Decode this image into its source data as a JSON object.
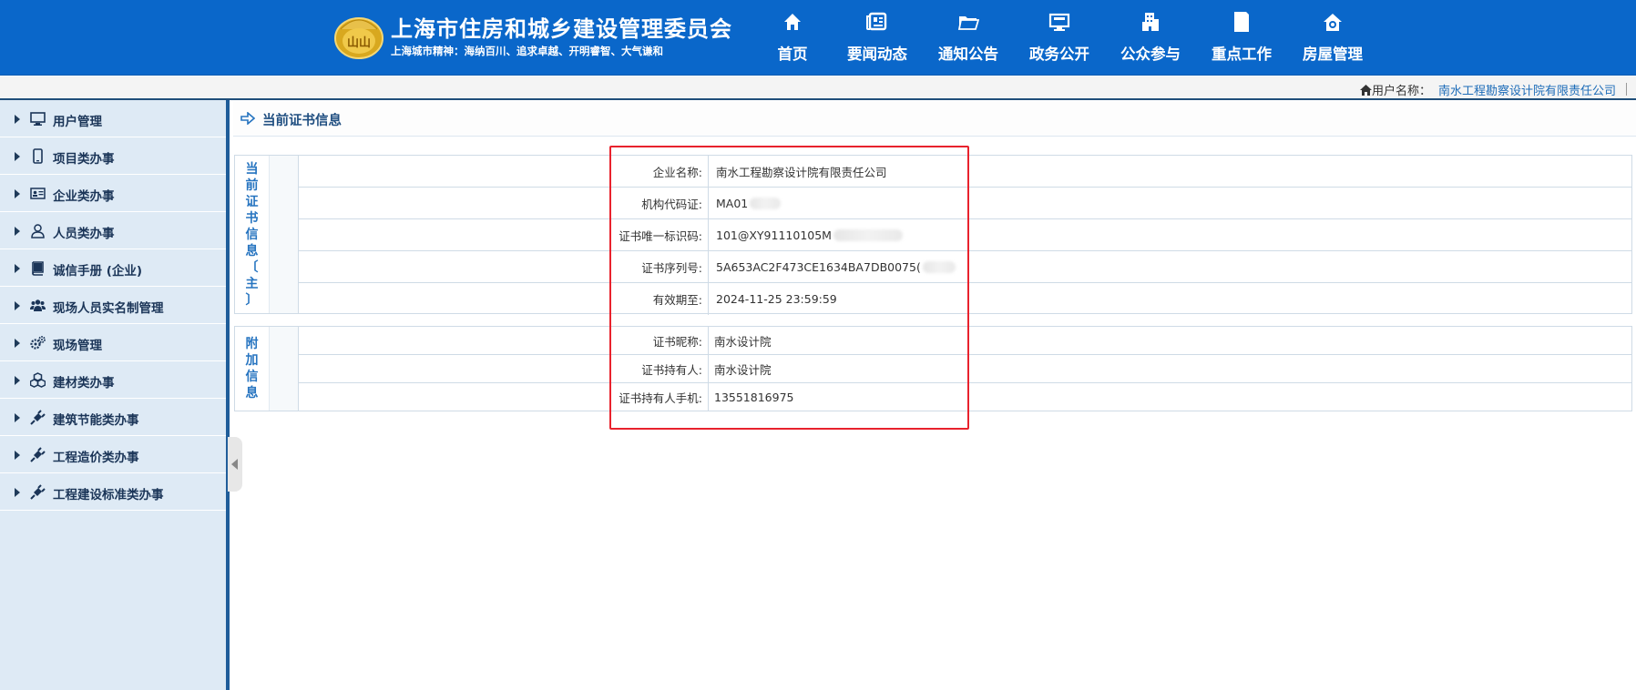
{
  "header": {
    "title": "上海市住房和城乡建设管理委员会",
    "slogan": "上海城市精神：海纳百川、追求卓越、开明睿智、大气谦和",
    "logo_text": "山山",
    "nav": [
      {
        "label": "首页",
        "icon": "home-icon"
      },
      {
        "label": "要闻动态",
        "icon": "news-icon"
      },
      {
        "label": "通知公告",
        "icon": "folder-icon"
      },
      {
        "label": "政务公开",
        "icon": "monitor-icon"
      },
      {
        "label": "公众参与",
        "icon": "building-icon"
      },
      {
        "label": "重点工作",
        "icon": "document-icon"
      },
      {
        "label": "房屋管理",
        "icon": "house-gear-icon"
      }
    ]
  },
  "userbar": {
    "label": "用户名称：",
    "username": "南水工程勘察设计院有限责任公司"
  },
  "sidebar": {
    "items": [
      {
        "label": "用户管理",
        "icon": "monitor-icon"
      },
      {
        "label": "项目类办事",
        "icon": "tablet-icon"
      },
      {
        "label": "企业类办事",
        "icon": "id-card-icon"
      },
      {
        "label": "人员类办事",
        "icon": "user-icon"
      },
      {
        "label": "诚信手册 (企业)",
        "icon": "book-icon"
      },
      {
        "label": "现场人员实名制管理",
        "icon": "group-icon"
      },
      {
        "label": "现场管理",
        "icon": "gears-icon"
      },
      {
        "label": "建材类办事",
        "icon": "cubes-icon"
      },
      {
        "label": "建筑节能类办事",
        "icon": "plug-icon"
      },
      {
        "label": "工程造价类办事",
        "icon": "plug-icon"
      },
      {
        "label": "工程建设标准类办事",
        "icon": "plug-icon"
      }
    ]
  },
  "panel": {
    "title": "当前证书信息"
  },
  "current_cert": {
    "label_chars": [
      "当",
      "前",
      "证",
      "书",
      "信",
      "息",
      "〔",
      "主",
      "〕"
    ],
    "rows": [
      {
        "key": "企业名称:",
        "value": "南水工程勘察设计院有限责任公司",
        "redacted": false
      },
      {
        "key": "机构代码证:",
        "value": "MA01",
        "redacted": true
      },
      {
        "key": "证书唯一标识码:",
        "value": "101@XY91110105M",
        "redacted": true
      },
      {
        "key": "证书序列号:",
        "value": "5A653AC2F473CE1634BA7DB0075(",
        "redacted": true
      },
      {
        "key": "有效期至:",
        "value": "2024-11-25 23:59:59",
        "redacted": false
      }
    ]
  },
  "extra_info": {
    "label_chars": [
      "附",
      "加",
      "信",
      "息"
    ],
    "rows": [
      {
        "key": "证书昵称:",
        "value": "南水设计院"
      },
      {
        "key": "证书持有人:",
        "value": "南水设计院"
      },
      {
        "key": "证书持有人手机:",
        "value": "13551816975"
      }
    ]
  },
  "colors": {
    "header_bg": "#0a67ca",
    "sidebar_bg": "#deeaf5",
    "highlight": "#e8222d",
    "link": "#1d6cb8"
  }
}
